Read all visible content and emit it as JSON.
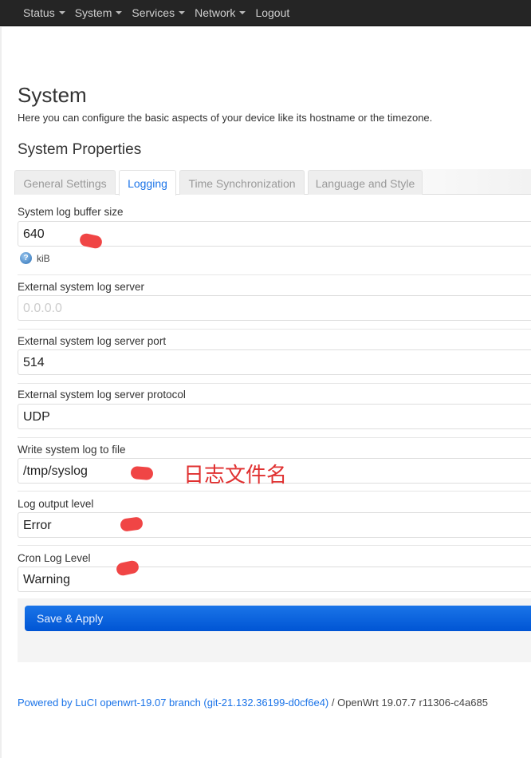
{
  "nav": {
    "items": [
      "Status",
      "System",
      "Services",
      "Network"
    ],
    "logout": "Logout"
  },
  "page": {
    "title": "System",
    "description": "Here you can configure the basic aspects of your device like its hostname or the timezone.",
    "section": "System Properties"
  },
  "tabs": [
    "General Settings",
    "Logging",
    "Time Synchronization",
    "Language and Style"
  ],
  "active_tab": "Logging",
  "fields": {
    "buffer": {
      "label": "System log buffer size",
      "value": "640",
      "help": "kiB"
    },
    "server": {
      "label": "External system log server",
      "placeholder": "0.0.0.0"
    },
    "port": {
      "label": "External system log server port",
      "value": "514"
    },
    "protocol": {
      "label": "External system log server protocol",
      "value": "UDP"
    },
    "file": {
      "label": "Write system log to file",
      "value": "/tmp/syslog"
    },
    "level": {
      "label": "Log output level",
      "value": "Error"
    },
    "cron": {
      "label": "Cron Log Level",
      "value": "Warning"
    }
  },
  "annotation": "日志文件名",
  "save_label": "Save & Apply",
  "footer": {
    "link": "Powered by LuCI openwrt-19.07 branch (git-21.132.36199-d0cf6e4)",
    "rest": " / OpenWrt 19.07.7 r11306-c4a685"
  }
}
